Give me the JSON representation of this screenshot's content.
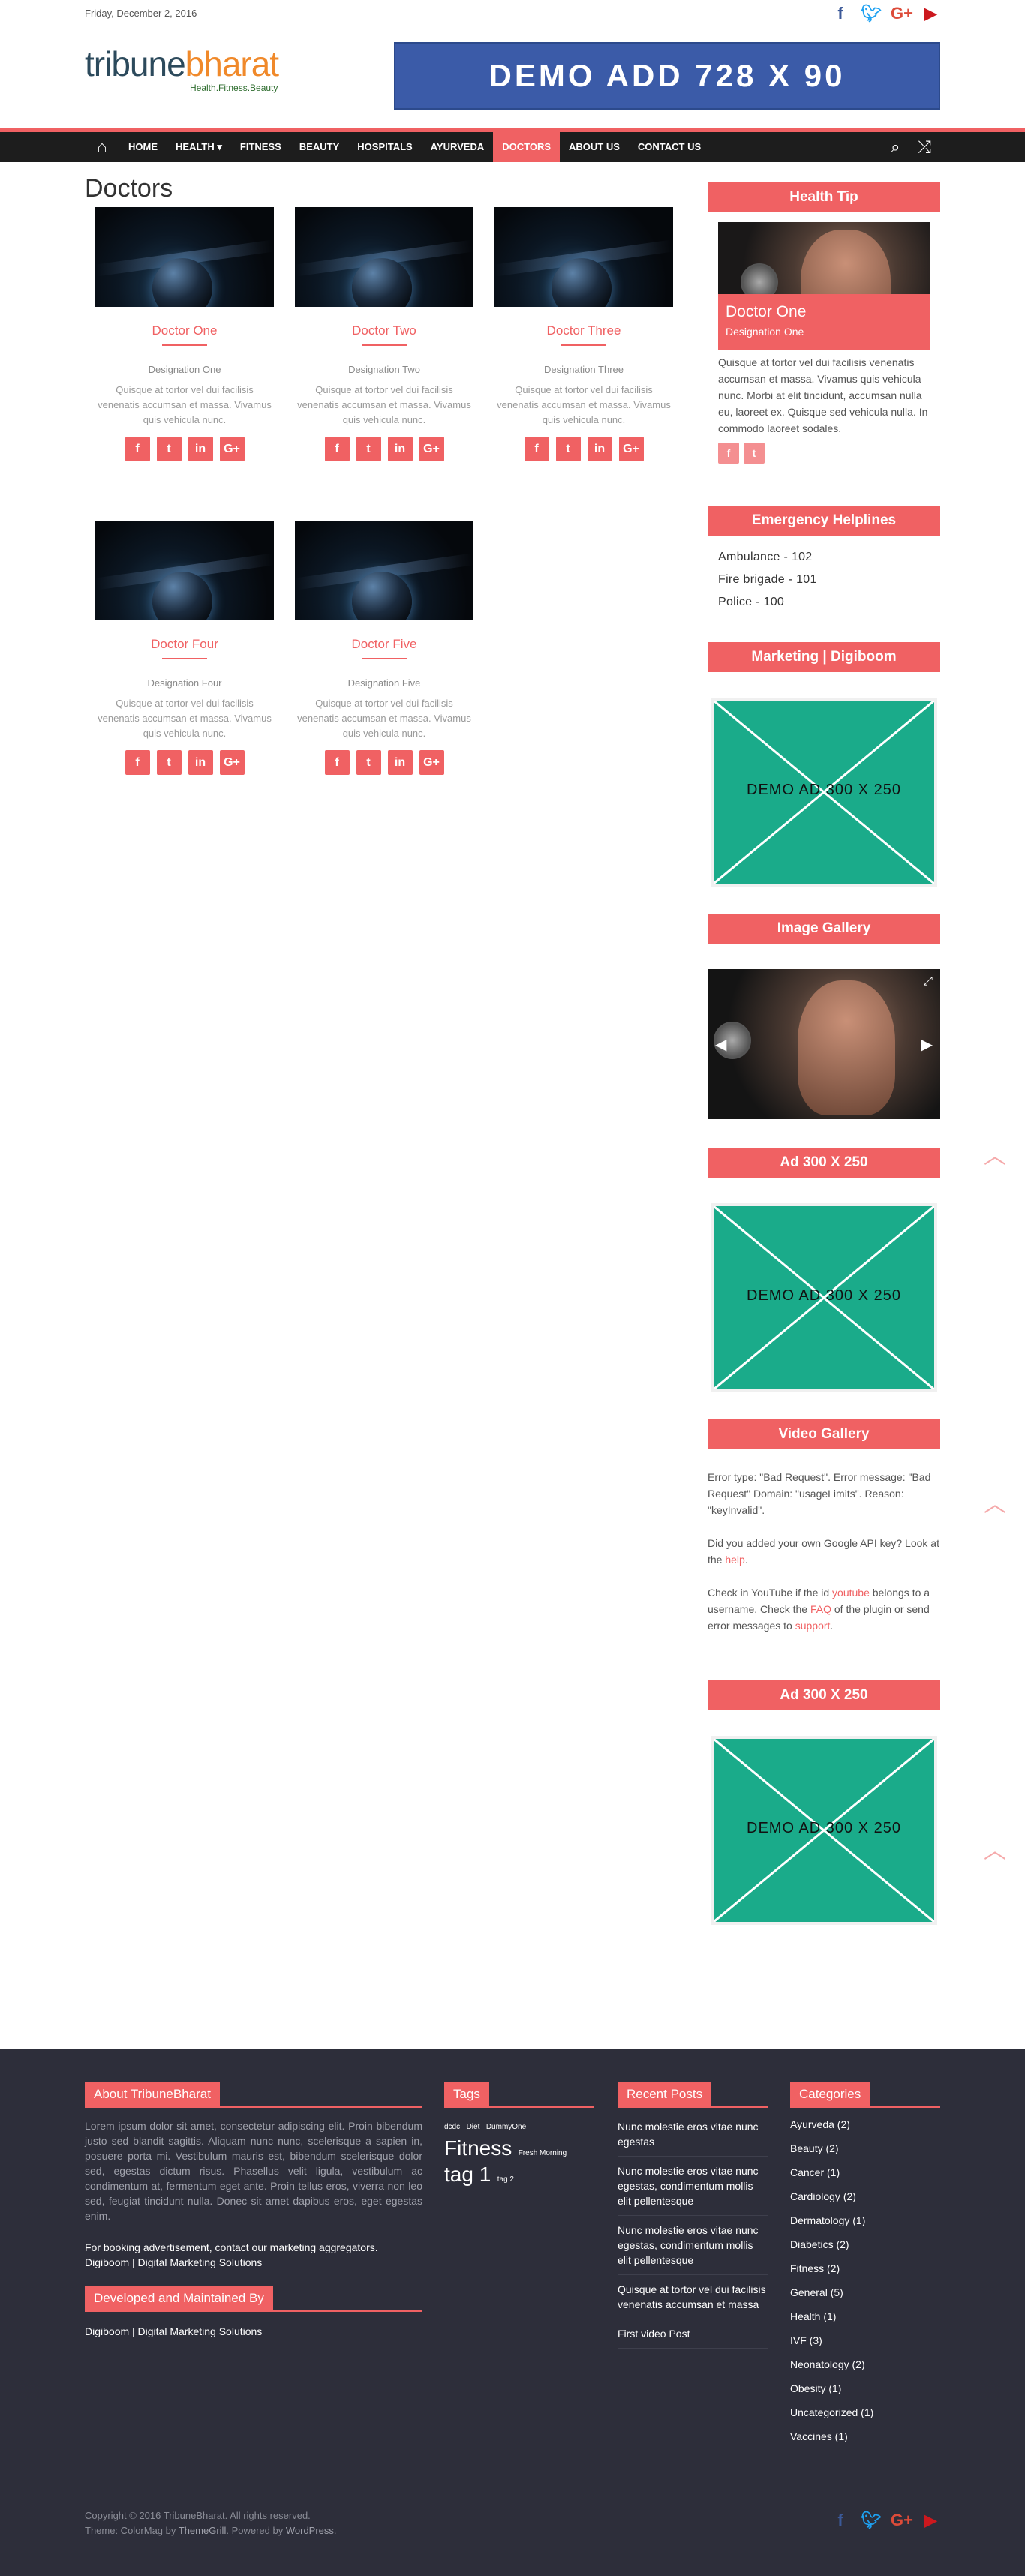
{
  "topbar": {
    "date": "Friday, December 2, 2016",
    "social": [
      "facebook-icon",
      "twitter-icon",
      "google-plus-icon",
      "youtube-icon"
    ]
  },
  "header": {
    "logo_text_a": "tribune",
    "logo_text_b": "bharat",
    "tagline": "Health.Fitness.Beauty",
    "banner_text": "DEMO ADD 728 X 90"
  },
  "nav": {
    "items": [
      "Home",
      "Health",
      "Fitness",
      "Beauty",
      "Hospitals",
      "Ayurveda",
      "Doctors",
      "About Us",
      "Contact Us"
    ],
    "health_caret": "▾",
    "active": "Doctors",
    "accent": "#f06163"
  },
  "page": {
    "title": "Doctors"
  },
  "doctors": [
    {
      "name": "Doctor One",
      "designation": "Designation One",
      "desc": "Quisque at tortor vel dui facilisis venenatis accumsan et massa. Vivamus quis vehicula nunc."
    },
    {
      "name": "Doctor Two",
      "designation": "Designation Two",
      "desc": "Quisque at tortor vel dui facilisis venenatis accumsan et massa. Vivamus quis vehicula nunc."
    },
    {
      "name": "Doctor Three",
      "designation": "Designation Three",
      "desc": "Quisque at tortor vel dui facilisis venenatis accumsan et massa. Vivamus quis vehicula nunc."
    },
    {
      "name": "Doctor Four",
      "designation": "Designation Four",
      "desc": "Quisque at tortor vel dui facilisis venenatis accumsan et massa. Vivamus quis vehicula nunc."
    },
    {
      "name": "Doctor Five",
      "designation": "Designation Five",
      "desc": "Quisque at tortor vel dui facilisis venenatis accumsan et massa. Vivamus quis vehicula nunc."
    }
  ],
  "doctor_social": [
    "f",
    "t",
    "in",
    "G+"
  ],
  "sidebar": {
    "health_tip": {
      "title": "Health Tip",
      "name": "Doctor One",
      "designation": "Designation One",
      "text": "Quisque at tortor vel dui facilisis venenatis accumsan et massa. Vivamus quis vehicula nunc. Morbi at elit tincidunt, accumsan nulla eu, laoreet ex. Quisque sed vehicula nulla. In commodo laoreet sodales."
    },
    "helplines": {
      "title": "Emergency Helplines",
      "items": [
        "Ambulance - 102",
        "Fire brigade - 101",
        "Police - 100"
      ]
    },
    "marketing_title": "Marketing | Digiboom",
    "ad_text": "DEMO AD 300 X 250",
    "gallery_title": "Image Gallery",
    "ad_title": "Ad 300 X 250",
    "video": {
      "title": "Video Gallery",
      "error": "Error type: \"Bad Request\". Error message: \"Bad Request\" Domain: \"usageLimits\". Reason: \"keyInvalid\".",
      "p2_a": "Did you added your own Google API key? Look at the ",
      "p2_link": "help",
      "p2_b": ".",
      "p3_a": "Check in YouTube if the id ",
      "p3_link1": "youtube",
      "p3_b": " belongs to a username. Check the ",
      "p3_link2": "FAQ",
      "p3_c": " of the plugin or send error messages to ",
      "p3_link3": "support",
      "p3_d": "."
    },
    "ad_title_2": "Ad 300 X 250"
  },
  "footer": {
    "about": {
      "title": "About TribuneBharat",
      "text": "Lorem ipsum dolor sit amet, consectetur adipiscing elit. Proin bibendum justo sed blandit sagittis. Aliquam nunc nunc, scelerisque a sapien in, posuere porta mi. Vestibulum mauris est, bibendum scelerisque dolor sed, egestas dictum risus. Phasellus velit ligula, vestibulum ac condimentum at, fermentum eget ante. Proin tellus eros, viverra non leo sed, feugiat tincidunt nulla. Donec sit amet dapibus eros, eget egestas enim.",
      "booking": "For booking advertisement, contact our marketing aggregators. Digiboom | Digital Marketing Solutions"
    },
    "maintained": {
      "title": "Developed and Maintained By",
      "text": "Digiboom | Digital Marketing Solutions"
    },
    "tags": {
      "title": "Tags",
      "small": [
        "dcdc",
        "Diet",
        "DummyOne"
      ],
      "fitness": "Fitness",
      "fresh": "Fresh Morning",
      "tag1": "tag 1",
      "tag2": "tag 2"
    },
    "recent": {
      "title": "Recent Posts",
      "items": [
        "Nunc molestie eros vitae nunc egestas",
        "Nunc molestie eros vitae nunc egestas, condimentum mollis elit pellentesque",
        "Nunc molestie eros vitae nunc egestas, condimentum mollis elit pellentesque",
        "Quisque at tortor vel dui facilisis venenatis accumsan et massa",
        "First video Post"
      ]
    },
    "categories": {
      "title": "Categories",
      "items": [
        "Ayurveda (2)",
        "Beauty (2)",
        "Cancer (1)",
        "Cardiology (2)",
        "Dermatology (1)",
        "Diabetics (2)",
        "Fitness (2)",
        "General (5)",
        "Health (1)",
        "IVF (3)",
        "Neonatology (2)",
        "Obesity (1)",
        "Uncategorized (1)",
        "Vaccines (1)"
      ]
    },
    "copyright": "Copyright © 2016 TribuneBharat. All rights reserved.",
    "theme_a": "Theme: ColorMag by ",
    "theme_link1": "ThemeGrill",
    "theme_b": ". Powered by ",
    "theme_link2": "WordPress",
    "theme_c": "."
  }
}
